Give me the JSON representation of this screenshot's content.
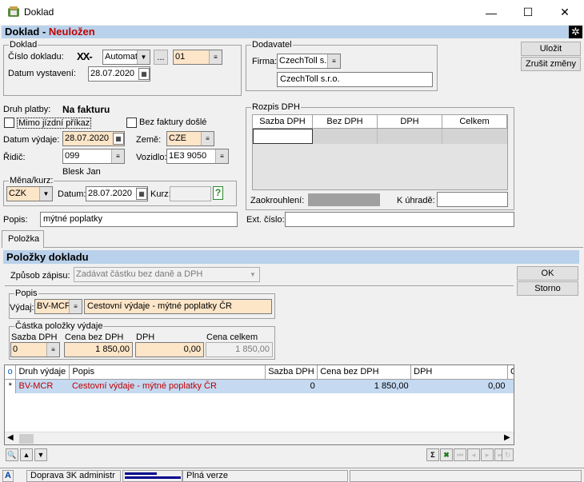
{
  "window": {
    "title": "Doklad",
    "minimize": "—",
    "maximize": "☐",
    "close": "✕"
  },
  "header": {
    "title": "Doklad - ",
    "status": "Neuložen"
  },
  "doklad": {
    "group": "Doklad",
    "cislo_label": "Číslo dokladu:",
    "cislo_prefix": "XX-",
    "cislo_mode": "Automat",
    "cislo_ellipsis": "...",
    "cislo_series": "01",
    "datum_label": "Datum vystavení:",
    "datum": "28.07.2020"
  },
  "dodavatel": {
    "group": "Dodavatel",
    "firma_label": "Firma:",
    "firma_code": "CzechToll s.",
    "firma_name": "CzechToll s.r.o."
  },
  "actions": {
    "save": "Uložit",
    "cancel": "Zrušit změny"
  },
  "platba": {
    "druh_label": "Druh platby:",
    "druh_value": "Na fakturu",
    "mimo_label": "Mimo jízdní příkaz",
    "bez_faktury_label": "Bez faktury došlé",
    "datum_vydaje_label": "Datum výdaje:",
    "datum_vydaje": "28.07.2020",
    "zeme_label": "Země:",
    "zeme": "CZE",
    "ridic_label": "Řidič:",
    "ridic": "099",
    "ridic_name": "Blesk Jan",
    "vozidlo_label": "Vozidlo:",
    "vozidlo": "1E3 9050"
  },
  "mena": {
    "group": "Měna/kurz:",
    "mena": "CZK",
    "datum_label": "Datum:",
    "datum": "28.07.2020",
    "kurz_label": "Kurz:",
    "kurz_help": "?"
  },
  "dph": {
    "group": "Rozpis DPH",
    "headers": [
      "Sazba DPH",
      "Bez DPH",
      "DPH",
      "Celkem"
    ],
    "zaokrouhleni_label": "Zaokrouhlení:",
    "k_uhrade_label": "K úhradě:"
  },
  "popis": {
    "label": "Popis:",
    "value": "mýtné poplatky",
    "ext_label": "Ext. číslo:",
    "ext_value": ""
  },
  "tab": {
    "label": "Položka"
  },
  "polozky": {
    "header": "Položky dokladu",
    "zpusob_label": "Způsob zápisu:",
    "zpusob_value": "Zadávat částku bez daně a DPH",
    "ok": "OK",
    "storno": "Storno",
    "popis_group": "Popis",
    "vydaj_label": "Výdaj:",
    "vydaj_code": "BV-MCF",
    "vydaj_text": "Cestovní výdaje - mýtné poplatky ČR",
    "castka_group": "Částka položky výdaje",
    "sazba_label": "Sazba DPH",
    "sazba": "0",
    "cena_bez_label": "Cena bez DPH",
    "cena_bez": "1 850,00",
    "dph_label": "DPH",
    "dph": "0,00",
    "celkem_label": "Cena celkem",
    "celkem": "1 850,00"
  },
  "grid": {
    "corner": "o",
    "headers": [
      "Druh výdaje",
      "Popis",
      "Sazba DPH",
      "Cena bez DPH",
      "DPH",
      "C"
    ],
    "rows": [
      {
        "marker": "*",
        "druh": "BV-MCR",
        "popis": "Cestovní výdaje - mýtné poplatky ČR",
        "sazba": "0",
        "cena_bez": "1 850,00",
        "dph": "0,00"
      }
    ]
  },
  "statusbar": {
    "indicator": "A",
    "app": "Doprava 3K administr",
    "version": "Plná verze"
  },
  "colors": {
    "header_bg": "#b9d1ea",
    "status_red": "#c00000",
    "peach": "#fde5c8",
    "selected_row": "#c5d9f1"
  }
}
